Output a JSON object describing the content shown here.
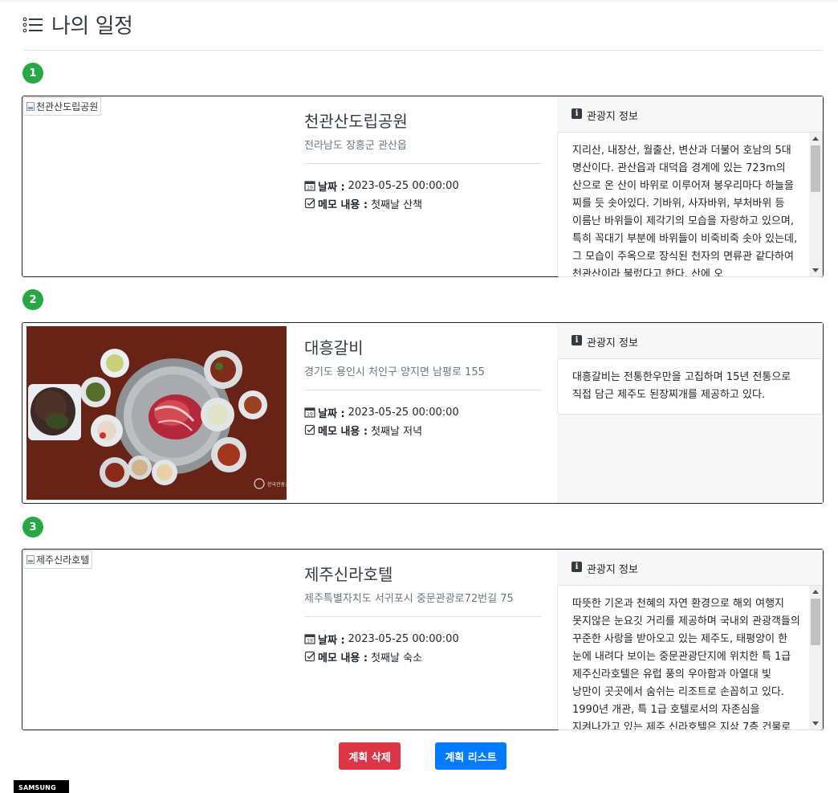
{
  "page": {
    "title": "나의 일정"
  },
  "plans": [
    {
      "number": "1",
      "image_alt": "천관산도립공원",
      "name": "천관산도립공원",
      "address": "전라남도 장흥군 관산읍",
      "date_label": "날짜 :",
      "date_value": "2023-05-25 00:00:00",
      "memo_label": "메모 내용 :",
      "memo_value": "첫째날 산책",
      "info_title": "관광지 정보",
      "description": "지리산, 내장산, 월출산, 변산과 더불어 호남의 5대 명산이다. 관산읍과 대덕읍 경계에 있는 723m의 산으로 온 산이 바위로 이루어져 봉우리마다 하늘을 찌를 듯 솟아있다. 기바위, 사자바위, 부처바위 등 이름난 바위들이 제각기의 모습을 자랑하고 있으며, 특히 꼭대기 부분에 바위들이 비죽비죽 솟아 있는데, 그 모습이 주옥으로 장식된 천자의 면류관 같다하여 천관산이라 불렀다고 한다. 산에 오"
    },
    {
      "number": "2",
      "image_alt": "대흥갈비",
      "name": "대흥갈비",
      "address": "경기도 용인시 처인구 양지면 남평로 155",
      "date_label": "날짜 :",
      "date_value": "2023-05-25 00:00:00",
      "memo_label": "메모 내용 :",
      "memo_value": "첫째날 저녁",
      "info_title": "관광지 정보",
      "description": "대흥갈비는 전통한우만을 고집하며 15년 전통으로 직접 담근 제주도 된장찌개를 제공하고 있다."
    },
    {
      "number": "3",
      "image_alt": "제주신라호텔",
      "name": "제주신라호텔",
      "address": "제주특별자치도 서귀포시 중문관광로72번길 75",
      "date_label": "날짜 :",
      "date_value": "2023-05-25 00:00:00",
      "memo_label": "메모 내용 :",
      "memo_value": "첫째날 숙소",
      "info_title": "관광지 정보",
      "description": "따뜻한 기온과 천혜의 자연 환경으로 해외 여행지 못지않은 눈요깃 거리를 제공하며 국내외 관광객들의 꾸준한 사랑을 받아오고 있는 제주도, 태평양이 한 눈에 내려다 보이는 중문관광단지에 위치한 특 1급 제주신라호텔은 유럽 풍의 우아함과 아열대 빛 낭만이 곳곳에서 숨쉬는 리조트로 손꼽히고 있다. 1990년 개관, 특 1급 호텔로서의 자존심을 지켜나가고 있는 제주 신라호텔은 지상 7층 건물로"
    }
  ],
  "photo_watermark": "한국관광공사",
  "buttons": {
    "delete": "계획 삭제",
    "list": "계획 리스트"
  },
  "brand": "SAMSUNG",
  "colors": {
    "number_badge": "#28a745",
    "delete_button": "#dc3545",
    "list_button": "#007bff"
  }
}
